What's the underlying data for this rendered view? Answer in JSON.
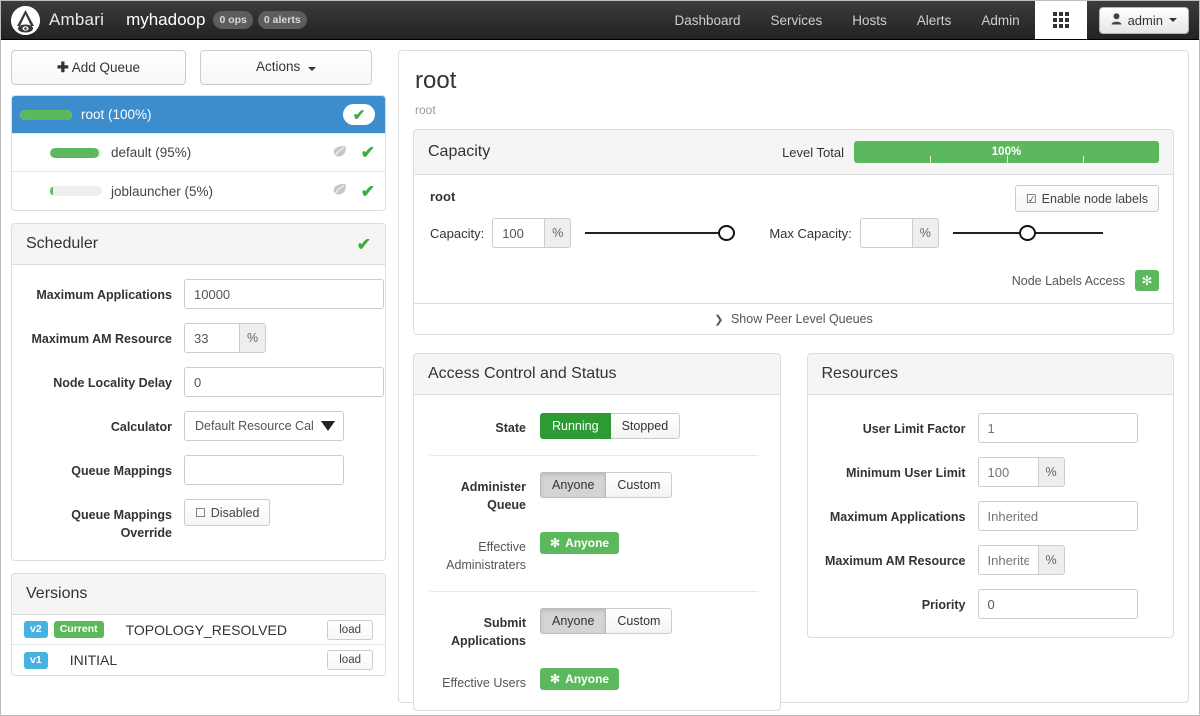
{
  "navbar": {
    "brand": "Ambari",
    "cluster": "myhadoop",
    "ops_badge": "0 ops",
    "alerts_badge": "0 alerts",
    "items": [
      {
        "label": "Dashboard"
      },
      {
        "label": "Services"
      },
      {
        "label": "Hosts"
      },
      {
        "label": "Alerts"
      },
      {
        "label": "Admin"
      }
    ],
    "grid_icon": "grid-icon",
    "user": "admin"
  },
  "toolbar": {
    "add_queue": "Add Queue",
    "add_queue_icon": "plus-icon",
    "actions": "Actions"
  },
  "queues": [
    {
      "name": "root (100%)",
      "percent": 100,
      "selected": true,
      "leaf": false,
      "status_icon": "check-icon"
    },
    {
      "name": "default (95%)",
      "percent": 95,
      "selected": false,
      "leaf": true,
      "leaf_icon": "leaf-icon",
      "status_icon": "check-icon"
    },
    {
      "name": "joblauncher (5%)",
      "percent": 5,
      "selected": false,
      "leaf": true,
      "leaf_icon": "leaf-icon",
      "status_icon": "check-icon"
    }
  ],
  "scheduler": {
    "title": "Scheduler",
    "status_icon": "check-icon",
    "fields": {
      "max_applications_label": "Maximum Applications",
      "max_applications_value": "10000",
      "max_am_resource_label": "Maximum AM Resource",
      "max_am_resource_value": "33",
      "percent_sign": "%",
      "node_locality_delay_label": "Node Locality Delay",
      "node_locality_delay_value": "0",
      "calculator_label": "Calculator",
      "calculator_value": "Default Resource Cal",
      "queue_mappings_label": "Queue Mappings",
      "queue_mappings_value": "",
      "queue_mappings_override_label": "Queue Mappings Override",
      "queue_mappings_override_value": "Disabled",
      "checkbox_icon": "checkbox-empty-icon"
    }
  },
  "versions": {
    "title": "Versions",
    "rows": [
      {
        "version": "v2",
        "badge": "Current",
        "name": "TOPOLOGY_RESOLVED",
        "action": "load"
      },
      {
        "version": "v1",
        "badge": "",
        "name": "INITIAL",
        "action": "load"
      }
    ]
  },
  "main": {
    "title": "root",
    "path": "root",
    "capacity": {
      "title": "Capacity",
      "level_total_label": "Level Total",
      "level_total_percent": 100,
      "level_total_text": "100%",
      "queue_name": "root",
      "capacity_label": "Capacity:",
      "capacity_value": "100",
      "capacity_slider_percent": 100,
      "max_capacity_label": "Max Capacity:",
      "max_capacity_value": "",
      "max_capacity_slider_percent": 50,
      "percent_sign": "%",
      "enable_node_labels": "Enable node labels",
      "enable_node_labels_icon": "checkbox-checked-icon",
      "node_labels_access_label": "Node Labels Access",
      "node_labels_access_badge": "✻",
      "show_peer_queues": "Show Peer Level Queues",
      "show_peer_queues_icon": "chevron-down-icon"
    },
    "access_control": {
      "title": "Access Control and Status",
      "state_label": "State",
      "state_options": [
        "Running",
        "Stopped"
      ],
      "state_selected": "Running",
      "administer_queue_label": "Administer Queue",
      "administer_queue_options": [
        "Anyone",
        "Custom"
      ],
      "administer_queue_selected": "Anyone",
      "effective_administraters_label": "Effective Administraters",
      "effective_administraters_value": "Anyone",
      "submit_applications_label": "Submit Applications",
      "submit_applications_options": [
        "Anyone",
        "Custom"
      ],
      "submit_applications_selected": "Anyone",
      "effective_users_label": "Effective Users",
      "effective_users_value": "Anyone",
      "asterisk": "✻"
    },
    "resources": {
      "title": "Resources",
      "user_limit_factor_label": "User Limit Factor",
      "user_limit_factor_placeholder": "1",
      "minimum_user_limit_label": "Minimum User Limit",
      "minimum_user_limit_placeholder": "100",
      "maximum_applications_label": "Maximum Applications",
      "maximum_applications_placeholder": "Inherited",
      "maximum_am_resource_label": "Maximum AM Resource",
      "maximum_am_resource_placeholder": "Inherited",
      "priority_label": "Priority",
      "priority_value": "0",
      "percent_sign": "%"
    }
  },
  "colors": {
    "accent_blue": "#3c8dcd",
    "green": "#5cb85c",
    "dark_green": "#2d9b34",
    "navbar": "#2c2c2c",
    "tag_blue": "#45b3e0"
  }
}
